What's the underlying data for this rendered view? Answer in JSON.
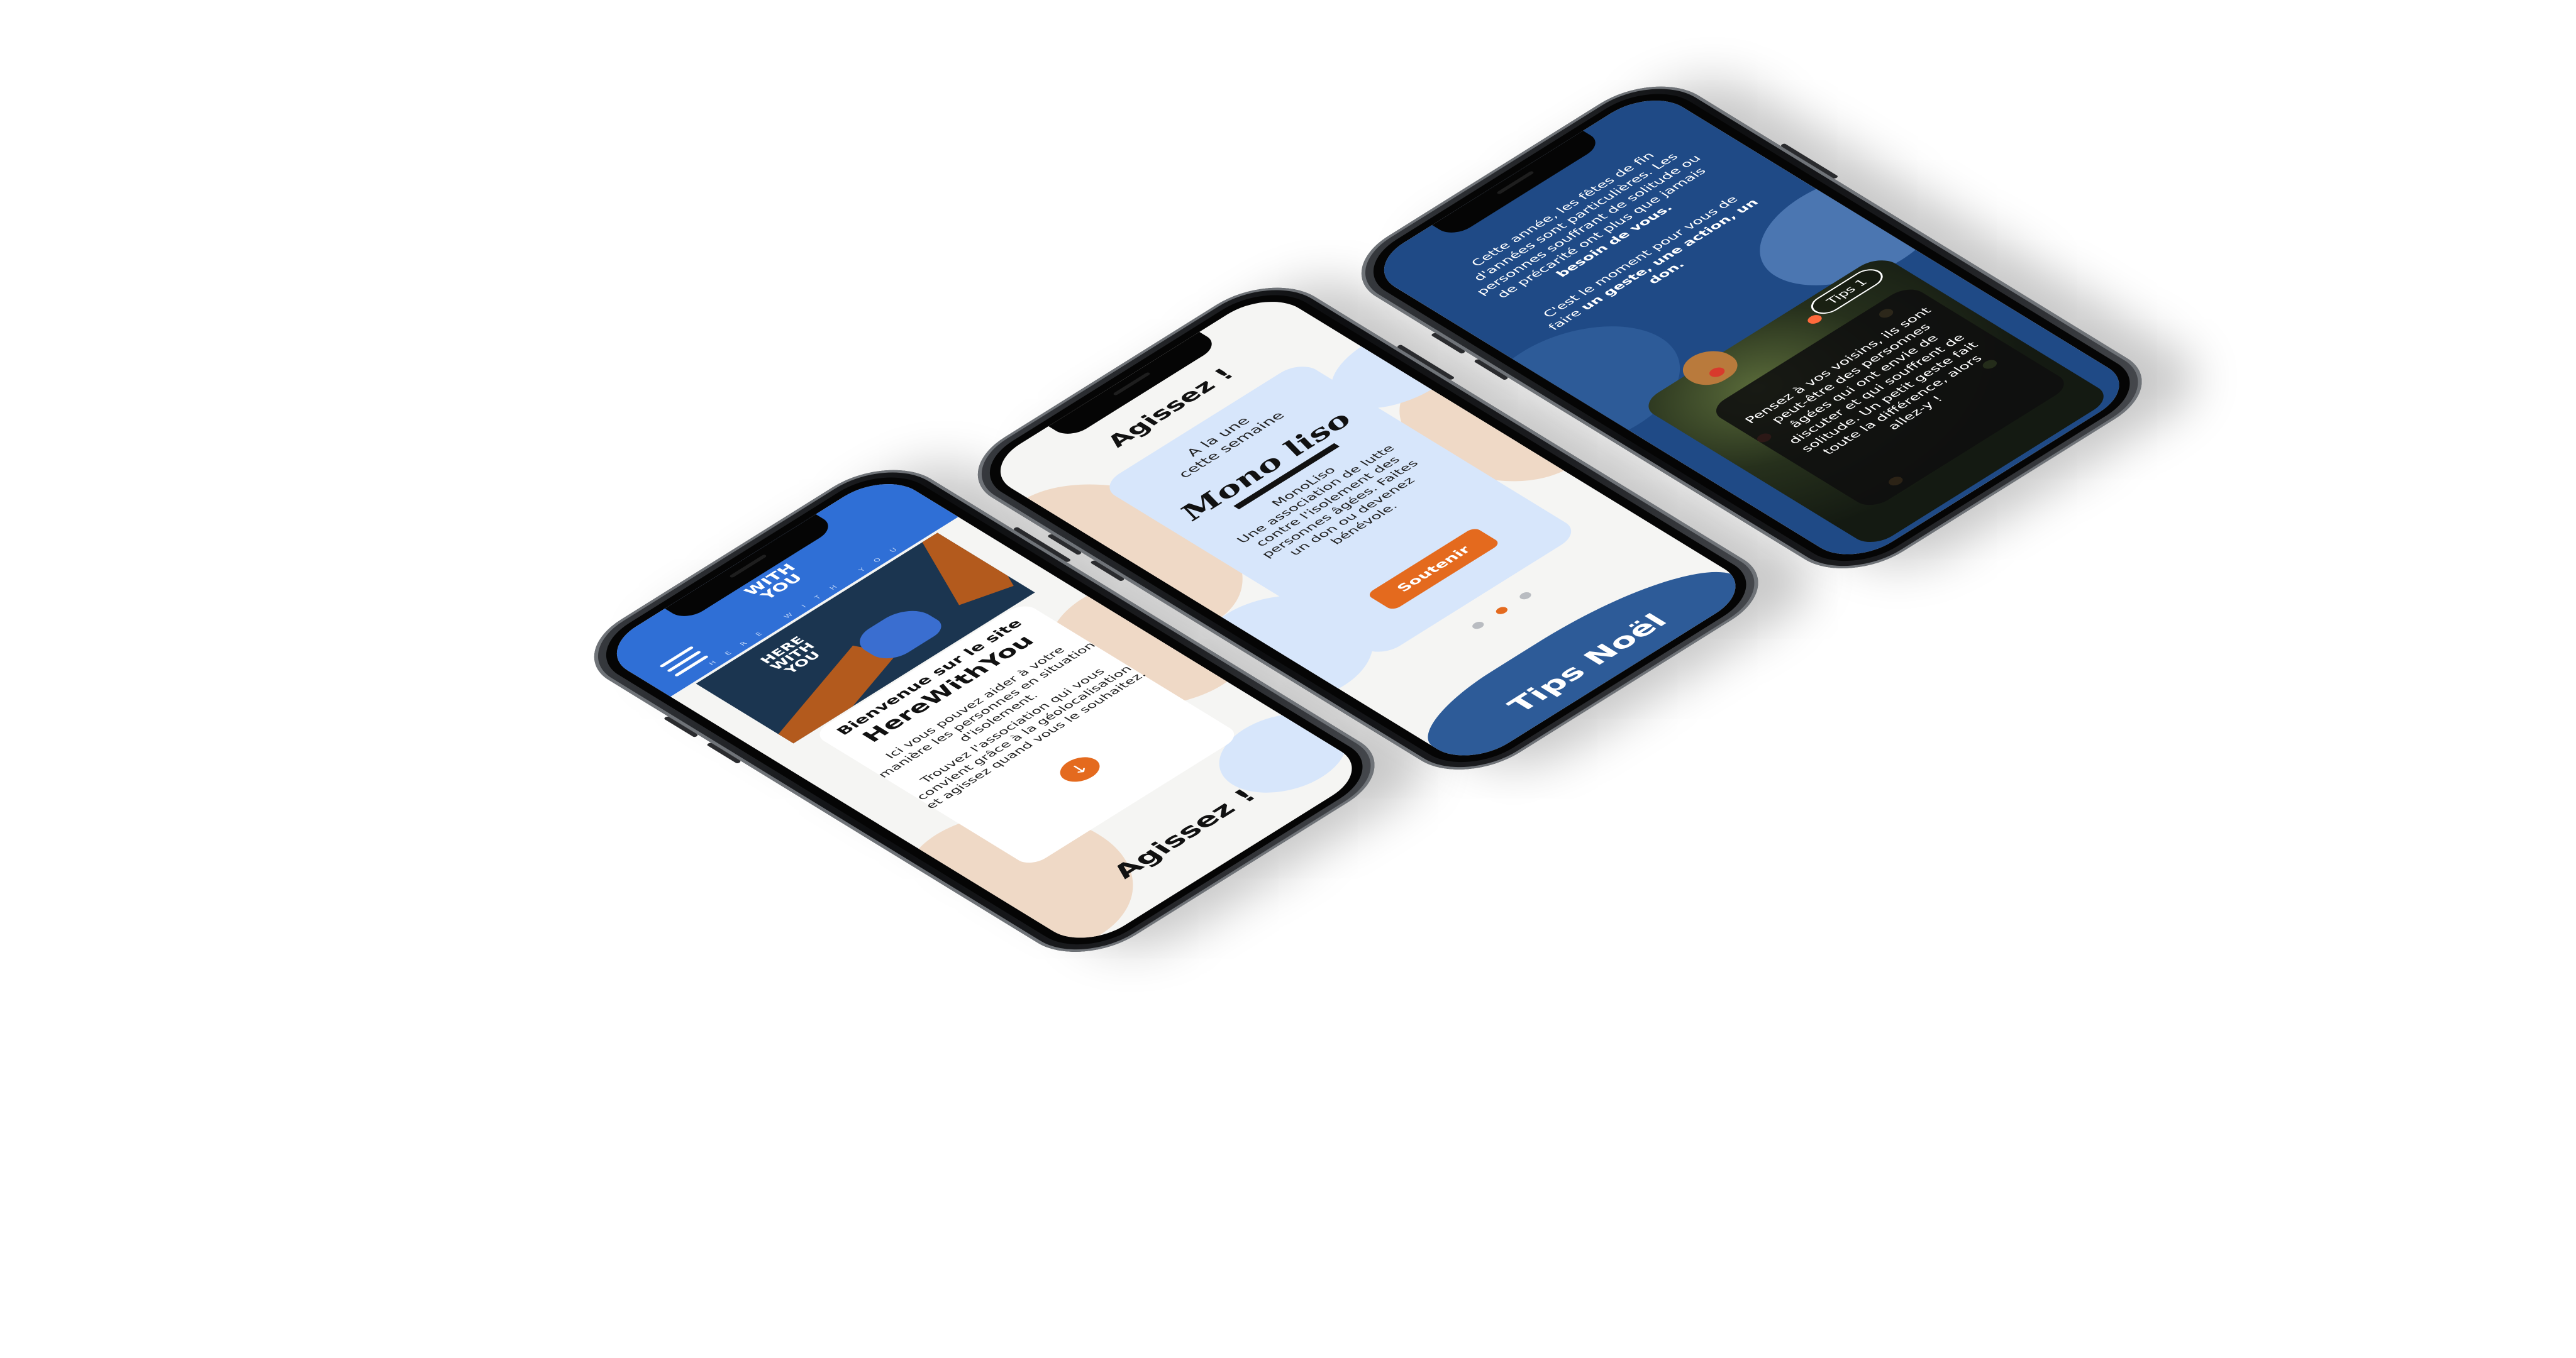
{
  "screen1": {
    "logo_top": "WITH",
    "logo_bottom": "YOU",
    "tagline": "HERE WITH YOU",
    "hero_logo_line1": "HERE",
    "hero_logo_line2": "WITH",
    "hero_logo_line3": "YOU",
    "title_line1": "Bienvenue sur le site",
    "title_line2": "HereWithYou",
    "body_p1": "Ici vous pouvez aider à votre manière les personnes en situation d'isolement.",
    "body_p2": "Trouvez l'association qui vous convient grâce à la géolocalisation et agissez quand vous le souhaitez.",
    "down_arrow": "↓",
    "cta": "Agissez !"
  },
  "screen2": {
    "title": "Agissez !",
    "feature_line1": "A la une",
    "feature_line2": "cette semaine",
    "brand_logo": "Mono liso",
    "body_name": "MonoLiso",
    "body_text": "Une association de lutte contre l'isolement des personnes âgées. Faites un don ou devenez bénévole.",
    "button": "Soutenir",
    "footer_text": "Tips Noël"
  },
  "screen3": {
    "p1_plain": "Cette année, les fêtes de fin d'années sont particulières. Les personnes souffrant de solitude ou de précarité ont plus que jamais ",
    "p1_bold": "besoin de vous.",
    "p2_plain": "C'est le moment pour vous de faire ",
    "p2_bold": "un geste, une action, un don.",
    "tips_pill": "Tips 1",
    "tip_text": "Pensez à vos voisins, ils sont peut-être des personnes âgées qui ont envie de discuter et qui souffrent de solitude. Un petit geste fait toute la différence, alors allez-y !"
  },
  "colors": {
    "brand_blue": "#2f6fd6",
    "accent_orange": "#e46a1e",
    "navy": "#1f4a86",
    "light_blue_card": "#d7e6fb",
    "peach": "#efd9c6"
  }
}
